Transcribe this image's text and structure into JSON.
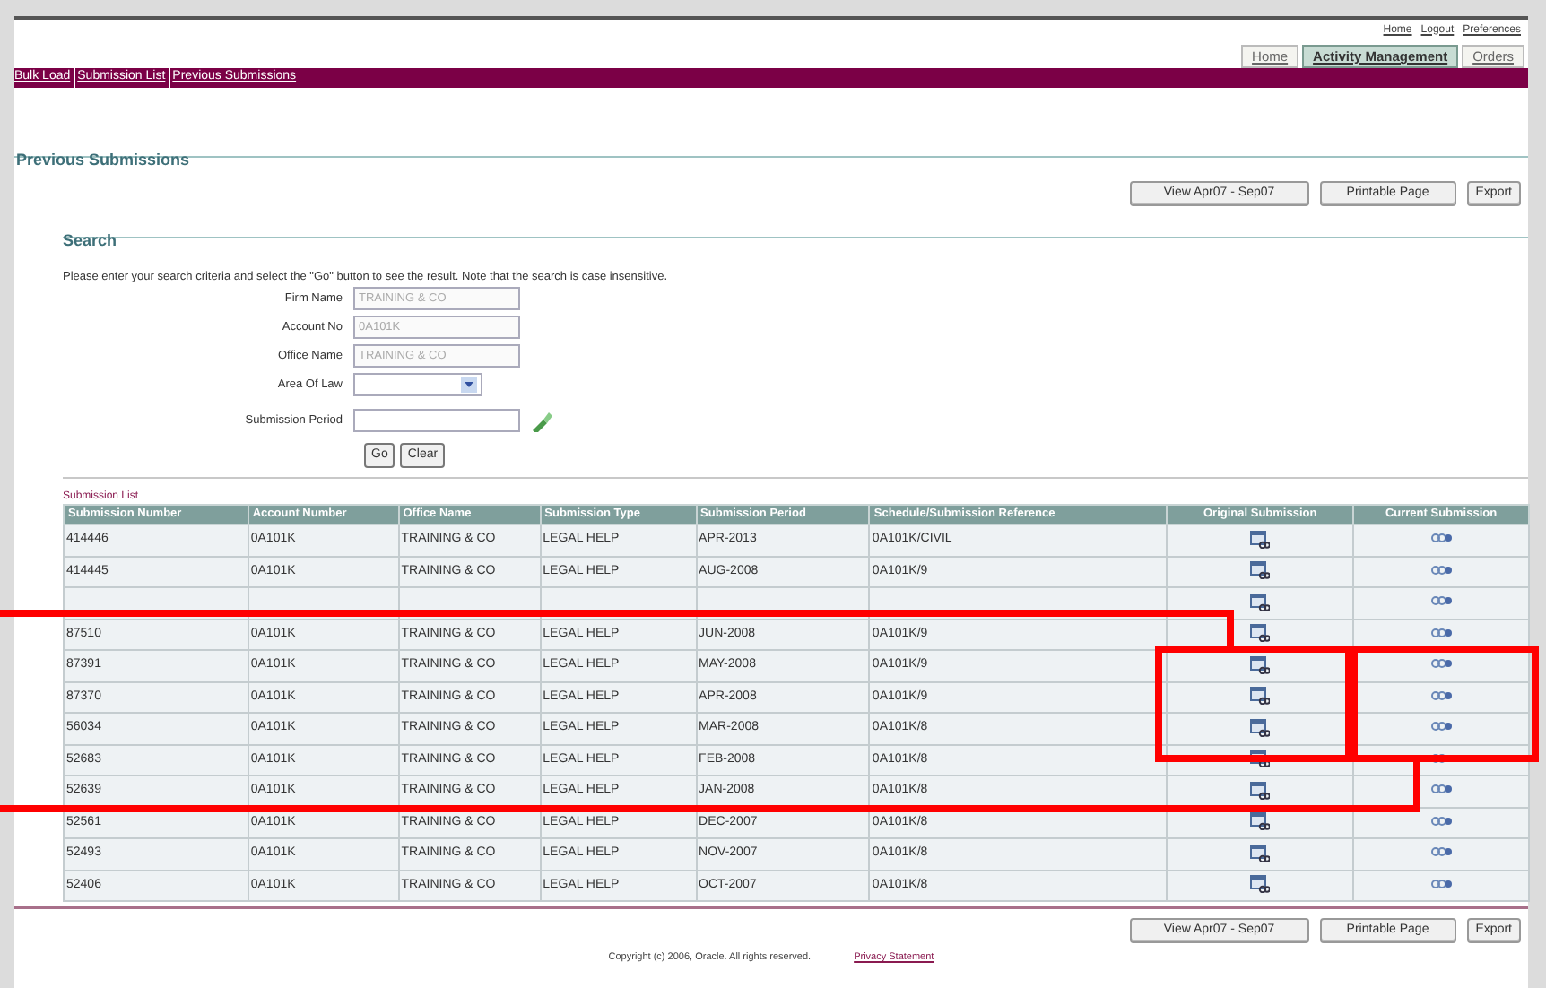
{
  "top_links": [
    "Home",
    "Logout",
    "Preferences"
  ],
  "tabs": [
    {
      "label": "Home",
      "selected": false
    },
    {
      "label": "Activity Management",
      "selected": true
    },
    {
      "label": "Orders",
      "selected": false
    }
  ],
  "nav_links": [
    "Bulk Load",
    "Submission List",
    "Previous Submissions"
  ],
  "page_title": "Previous Submissions",
  "top_buttons": [
    "View Apr07 - Sep07",
    "Printable Page",
    "Export"
  ],
  "search": {
    "title": "Search",
    "instructions": "Please enter your search criteria and select the \"Go\" button to see the result. Note that the search is case insensitive.",
    "fields": [
      {
        "label": "Firm Name",
        "kind": "text",
        "value": "TRAINING & CO",
        "disabled": true
      },
      {
        "label": "Account No",
        "kind": "text",
        "value": "0A101K",
        "disabled": true
      },
      {
        "label": "Office Name",
        "kind": "text",
        "value": "TRAINING & CO",
        "disabled": true
      },
      {
        "label": "Area Of Law",
        "kind": "select"
      },
      {
        "label": "Submission Period",
        "kind": "date"
      }
    ],
    "buttons": [
      "Go",
      "Clear"
    ]
  },
  "submission_list": {
    "title": "Submission List",
    "columns": [
      "Submission Number",
      "Account Number",
      "Office Name",
      "Submission Type",
      "Submission Period",
      "Schedule/Submission Reference",
      "Original Submission",
      "Current Submission"
    ],
    "rows": [
      {
        "cells": [
          "414446",
          "0A101K",
          "TRAINING & CO",
          "LEGAL HELP",
          "APR-2013",
          "0A101K/CIVIL"
        ]
      },
      {
        "cells": [
          "414445",
          "0A101K",
          "TRAINING & CO",
          "LEGAL HELP",
          "AUG-2008",
          "0A101K/9"
        ]
      },
      {},
      {
        "cells": [
          "87510",
          "0A101K",
          "TRAINING & CO",
          "LEGAL HELP",
          "JUN-2008",
          "0A101K/9"
        ]
      },
      {
        "cells": [
          "87391",
          "0A101K",
          "TRAINING & CO",
          "LEGAL HELP",
          "MAY-2008",
          "0A101K/9"
        ]
      },
      {
        "cells": [
          "87370",
          "0A101K",
          "TRAINING & CO",
          "LEGAL HELP",
          "APR-2008",
          "0A101K/9"
        ]
      },
      {
        "cells": [
          "56034",
          "0A101K",
          "TRAINING & CO",
          "LEGAL HELP",
          "MAR-2008",
          "0A101K/8"
        ]
      },
      {
        "cells": [
          "52683",
          "0A101K",
          "TRAINING & CO",
          "LEGAL HELP",
          "FEB-2008",
          "0A101K/8"
        ]
      },
      {
        "cells": [
          "52639",
          "0A101K",
          "TRAINING & CO",
          "LEGAL HELP",
          "JAN-2008",
          "0A101K/8"
        ]
      },
      {
        "cells": [
          "52561",
          "0A101K",
          "TRAINING & CO",
          "LEGAL HELP",
          "DEC-2007",
          "0A101K/8"
        ]
      },
      {
        "cells": [
          "52493",
          "0A101K",
          "TRAINING & CO",
          "LEGAL HELP",
          "NOV-2007",
          "0A101K/8"
        ]
      },
      {
        "cells": [
          "52406",
          "0A101K",
          "TRAINING & CO",
          "LEGAL HELP",
          "OCT-2007",
          "0A101K/8"
        ]
      }
    ]
  },
  "bottom_buttons": [
    "View Apr07 - Sep07",
    "Printable Page",
    "Export"
  ],
  "footer": {
    "copyright": "Copyright (c) 2006, Oracle. All rights reserved.",
    "privacy_link": "Privacy Statement"
  }
}
